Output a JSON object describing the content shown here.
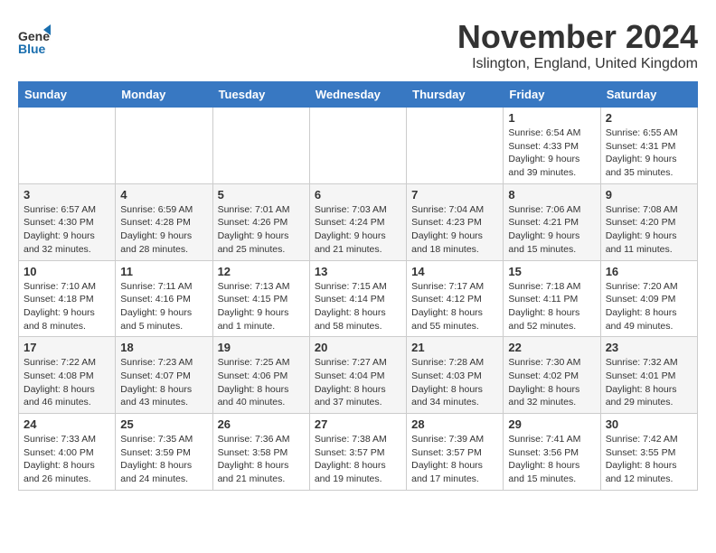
{
  "header": {
    "logo_line1": "General",
    "logo_line2": "Blue",
    "month_title": "November 2024",
    "location": "Islington, England, United Kingdom"
  },
  "days_of_week": [
    "Sunday",
    "Monday",
    "Tuesday",
    "Wednesday",
    "Thursday",
    "Friday",
    "Saturday"
  ],
  "weeks": [
    [
      {
        "day": "",
        "info": ""
      },
      {
        "day": "",
        "info": ""
      },
      {
        "day": "",
        "info": ""
      },
      {
        "day": "",
        "info": ""
      },
      {
        "day": "",
        "info": ""
      },
      {
        "day": "1",
        "info": "Sunrise: 6:54 AM\nSunset: 4:33 PM\nDaylight: 9 hours\nand 39 minutes."
      },
      {
        "day": "2",
        "info": "Sunrise: 6:55 AM\nSunset: 4:31 PM\nDaylight: 9 hours\nand 35 minutes."
      }
    ],
    [
      {
        "day": "3",
        "info": "Sunrise: 6:57 AM\nSunset: 4:30 PM\nDaylight: 9 hours\nand 32 minutes."
      },
      {
        "day": "4",
        "info": "Sunrise: 6:59 AM\nSunset: 4:28 PM\nDaylight: 9 hours\nand 28 minutes."
      },
      {
        "day": "5",
        "info": "Sunrise: 7:01 AM\nSunset: 4:26 PM\nDaylight: 9 hours\nand 25 minutes."
      },
      {
        "day": "6",
        "info": "Sunrise: 7:03 AM\nSunset: 4:24 PM\nDaylight: 9 hours\nand 21 minutes."
      },
      {
        "day": "7",
        "info": "Sunrise: 7:04 AM\nSunset: 4:23 PM\nDaylight: 9 hours\nand 18 minutes."
      },
      {
        "day": "8",
        "info": "Sunrise: 7:06 AM\nSunset: 4:21 PM\nDaylight: 9 hours\nand 15 minutes."
      },
      {
        "day": "9",
        "info": "Sunrise: 7:08 AM\nSunset: 4:20 PM\nDaylight: 9 hours\nand 11 minutes."
      }
    ],
    [
      {
        "day": "10",
        "info": "Sunrise: 7:10 AM\nSunset: 4:18 PM\nDaylight: 9 hours\nand 8 minutes."
      },
      {
        "day": "11",
        "info": "Sunrise: 7:11 AM\nSunset: 4:16 PM\nDaylight: 9 hours\nand 5 minutes."
      },
      {
        "day": "12",
        "info": "Sunrise: 7:13 AM\nSunset: 4:15 PM\nDaylight: 9 hours\nand 1 minute."
      },
      {
        "day": "13",
        "info": "Sunrise: 7:15 AM\nSunset: 4:14 PM\nDaylight: 8 hours\nand 58 minutes."
      },
      {
        "day": "14",
        "info": "Sunrise: 7:17 AM\nSunset: 4:12 PM\nDaylight: 8 hours\nand 55 minutes."
      },
      {
        "day": "15",
        "info": "Sunrise: 7:18 AM\nSunset: 4:11 PM\nDaylight: 8 hours\nand 52 minutes."
      },
      {
        "day": "16",
        "info": "Sunrise: 7:20 AM\nSunset: 4:09 PM\nDaylight: 8 hours\nand 49 minutes."
      }
    ],
    [
      {
        "day": "17",
        "info": "Sunrise: 7:22 AM\nSunset: 4:08 PM\nDaylight: 8 hours\nand 46 minutes."
      },
      {
        "day": "18",
        "info": "Sunrise: 7:23 AM\nSunset: 4:07 PM\nDaylight: 8 hours\nand 43 minutes."
      },
      {
        "day": "19",
        "info": "Sunrise: 7:25 AM\nSunset: 4:06 PM\nDaylight: 8 hours\nand 40 minutes."
      },
      {
        "day": "20",
        "info": "Sunrise: 7:27 AM\nSunset: 4:04 PM\nDaylight: 8 hours\nand 37 minutes."
      },
      {
        "day": "21",
        "info": "Sunrise: 7:28 AM\nSunset: 4:03 PM\nDaylight: 8 hours\nand 34 minutes."
      },
      {
        "day": "22",
        "info": "Sunrise: 7:30 AM\nSunset: 4:02 PM\nDaylight: 8 hours\nand 32 minutes."
      },
      {
        "day": "23",
        "info": "Sunrise: 7:32 AM\nSunset: 4:01 PM\nDaylight: 8 hours\nand 29 minutes."
      }
    ],
    [
      {
        "day": "24",
        "info": "Sunrise: 7:33 AM\nSunset: 4:00 PM\nDaylight: 8 hours\nand 26 minutes."
      },
      {
        "day": "25",
        "info": "Sunrise: 7:35 AM\nSunset: 3:59 PM\nDaylight: 8 hours\nand 24 minutes."
      },
      {
        "day": "26",
        "info": "Sunrise: 7:36 AM\nSunset: 3:58 PM\nDaylight: 8 hours\nand 21 minutes."
      },
      {
        "day": "27",
        "info": "Sunrise: 7:38 AM\nSunset: 3:57 PM\nDaylight: 8 hours\nand 19 minutes."
      },
      {
        "day": "28",
        "info": "Sunrise: 7:39 AM\nSunset: 3:57 PM\nDaylight: 8 hours\nand 17 minutes."
      },
      {
        "day": "29",
        "info": "Sunrise: 7:41 AM\nSunset: 3:56 PM\nDaylight: 8 hours\nand 15 minutes."
      },
      {
        "day": "30",
        "info": "Sunrise: 7:42 AM\nSunset: 3:55 PM\nDaylight: 8 hours\nand 12 minutes."
      }
    ]
  ]
}
